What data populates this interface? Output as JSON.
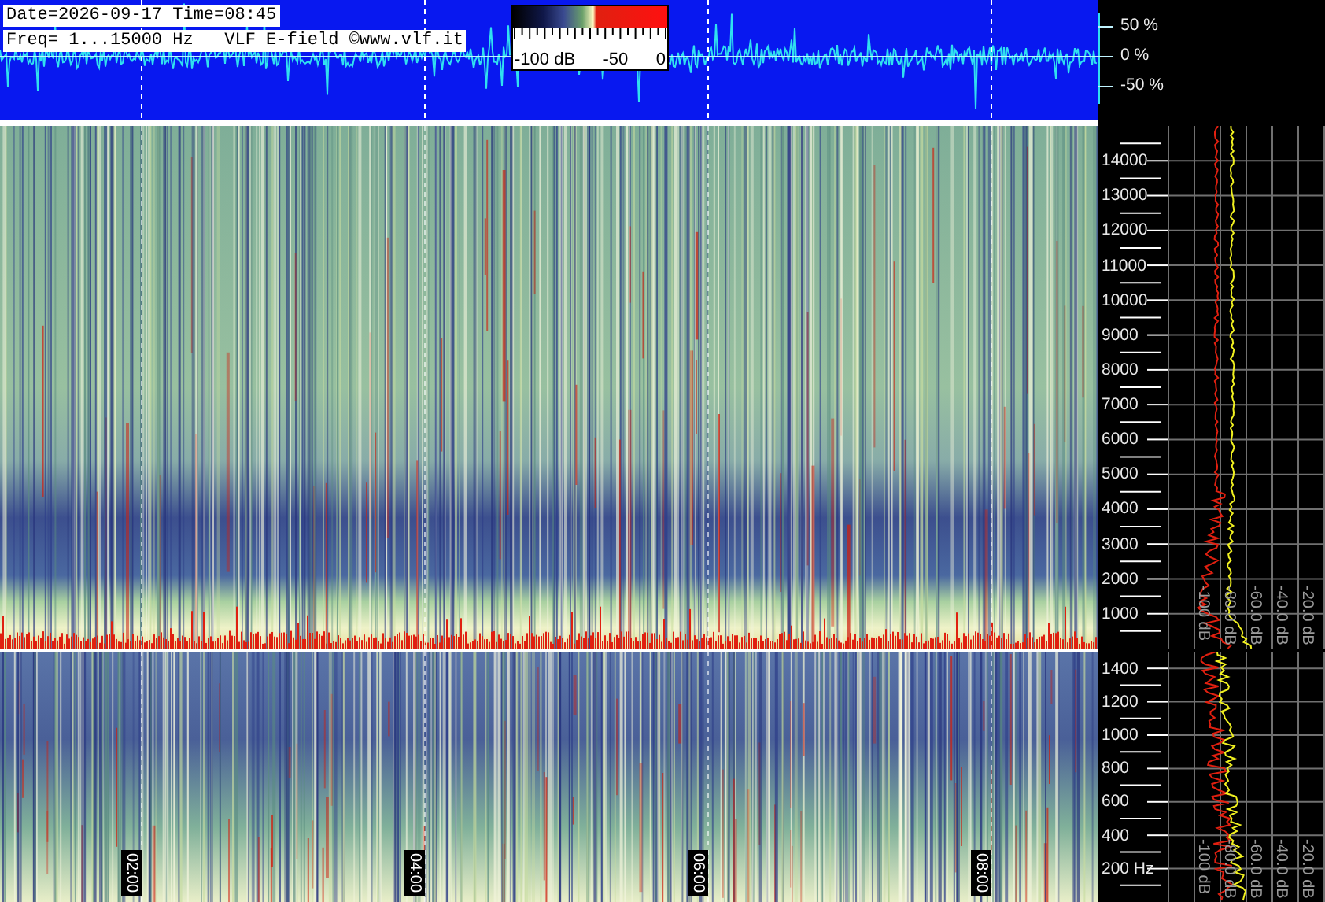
{
  "header": {
    "date_line": "Date=2026-09-17 Time=08:45",
    "freq_line": "Freq= 1...15000 Hz   VLF E-field ©www.vlf.it"
  },
  "color_scale": {
    "labels": [
      "-100 dB",
      "-50",
      "0"
    ]
  },
  "waveform_axis": [
    "50 %",
    "0 %",
    "-50 %"
  ],
  "upper_panel": {
    "freq_axis": [
      "14000",
      "13000",
      "12000",
      "11000",
      "10000",
      "9000",
      "8000",
      "7000",
      "6000",
      "5000",
      "4000",
      "3000",
      "2000",
      "1000"
    ],
    "spectrum_axis": [
      "-100 dB",
      "-80.0 dB",
      "-60.0 dB",
      "-40.0 dB",
      "-20.0 dB"
    ]
  },
  "lower_panel": {
    "freq_axis": [
      "1400",
      "1200",
      "1000",
      "800",
      "600",
      "400",
      "200 Hz"
    ],
    "spectrum_axis": [
      "-100 dB",
      "-80.0 dB",
      "-60.0 dB",
      "-40.0 dB",
      "-20.0 dB"
    ],
    "time_labels": [
      "02:00",
      "04:00",
      "06:00",
      "08:00"
    ]
  }
}
